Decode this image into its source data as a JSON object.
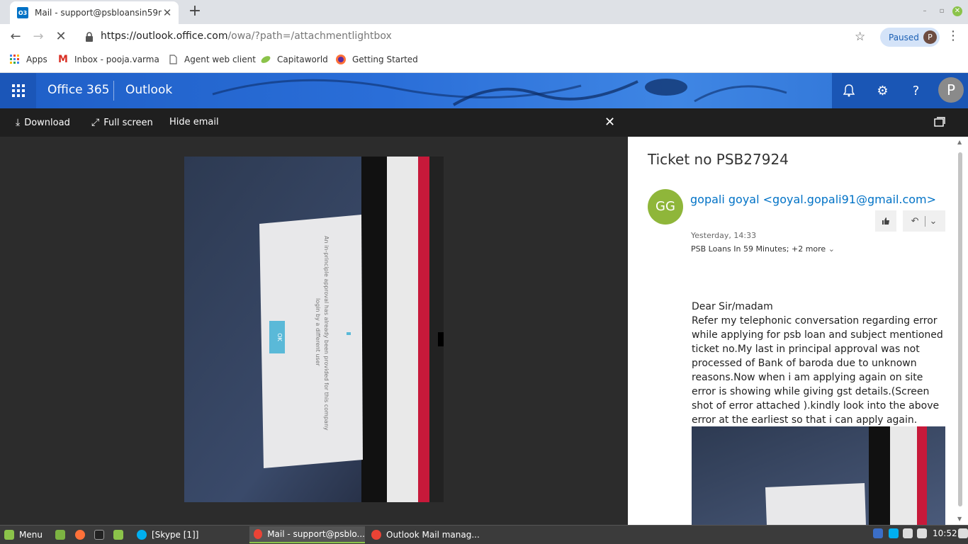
{
  "browser": {
    "tab_title": "Mail - support@psbloansin59m",
    "tab_favicon_text": "O3",
    "url_host": "https://outlook.office.com",
    "url_path": "/owa/?path=/attachmentlightbox",
    "paused_label": "Paused",
    "profile_initial": "P",
    "bookmarks": [
      "Apps",
      "Inbox - pooja.varma",
      "Agent web client",
      "Capitaworld",
      "Getting Started"
    ]
  },
  "o365": {
    "brand": "Office 365",
    "app": "Outlook",
    "avatar_initial": "P"
  },
  "lightbox": {
    "download": "Download",
    "fullscreen": "Full screen",
    "hide_email": "Hide email"
  },
  "attachment_text": {
    "message": "An in-principle approval has already been provided for this company",
    "message2": "login by a different user",
    "ok": "OK"
  },
  "email": {
    "subject": "Ticket no PSB27924",
    "sender_initials": "GG",
    "sender": "gopali goyal <goyal.gopali91@gmail.com>",
    "date": "Yesterday, 14:33",
    "recipients": "PSB Loans In 59 Minutes;",
    "more": "+2 more",
    "body": [
      "Dear Sir/madam",
      "Refer my telephonic conversation regarding error while applying for psb loan and subject mentioned ticket no.My last in principal approval was not processed of Bank of baroda due to unknown reasons.Now when i am applying again on site error is showing while giving gst details.(Screen shot of error attached ).kindly look into the above error at the earliest so that i can apply again."
    ]
  },
  "taskbar": {
    "menu": "Menu",
    "items": [
      "[Skype [1]]",
      "Mail - support@psblo...",
      "Outlook Mail manag..."
    ],
    "clock": "10:52"
  },
  "colors": {
    "o365_blue": "#1f5fc7",
    "sender_avatar": "#8fb63a",
    "link_blue": "#0072c6",
    "cmdbar": "#1f1f1f"
  }
}
